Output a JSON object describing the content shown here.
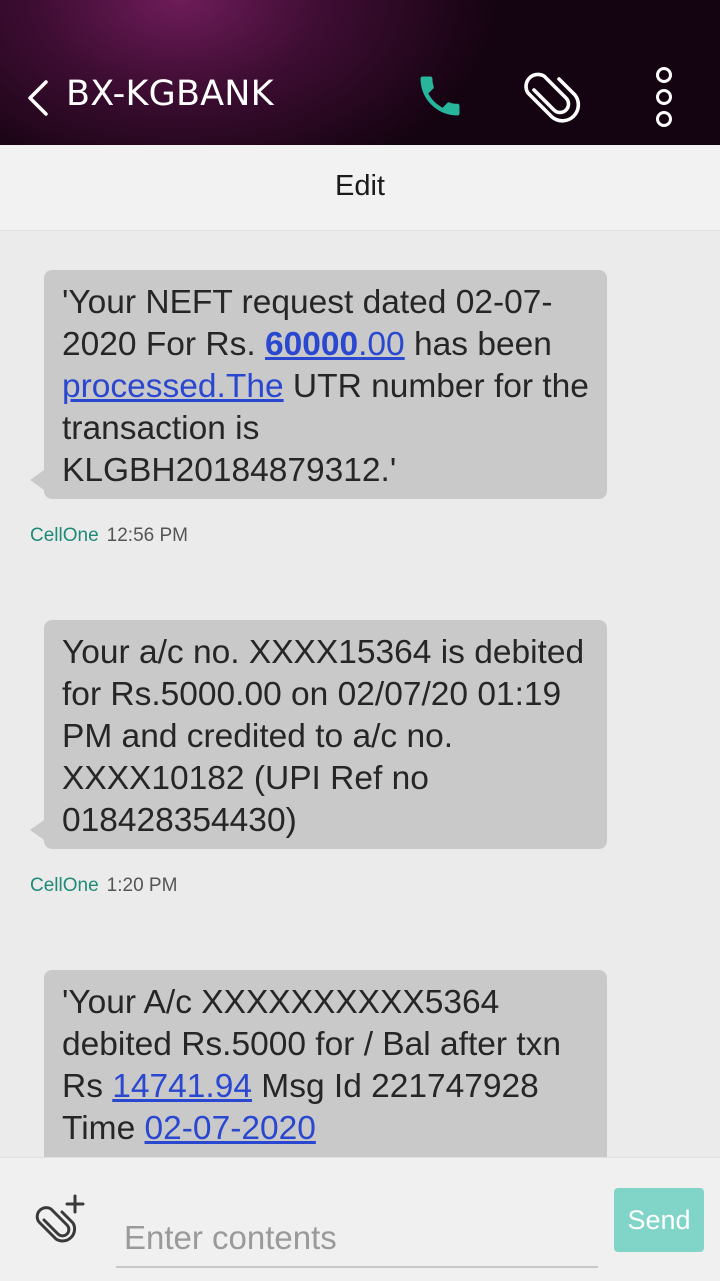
{
  "header": {
    "title": "BX-KGBANK",
    "icons": [
      "back-arrow-icon",
      "phone-icon",
      "paperclip-icon",
      "more-vertical-icon"
    ]
  },
  "edit_bar": {
    "label": "Edit"
  },
  "messages": [
    {
      "text_parts": [
        "'Your NEFT request dated 02-07-2020 For Rs. ",
        "60000",
        ".00",
        " has been ",
        "processed.The",
        " UTR number for the transaction is KLGBH20184879312.'"
      ],
      "sim": "CellOne",
      "time": "12:56 PM"
    },
    {
      "text": "Your a/c no. XXXX15364 is debited for Rs.5000.00 on 02/07/20 01:19 PM and credited to a/c no. XXXX10182 (UPI Ref no 018428354430)",
      "sim": "CellOne",
      "time": "1:20 PM"
    },
    {
      "text_parts": [
        "'Your A/c XXXXXXXXXX5364 debited Rs.5000 for / Bal after txn Rs ",
        "14741.94",
        " Msg Id 221747928 Time ",
        "02-07-2020"
      ]
    }
  ],
  "composer": {
    "placeholder": "Enter contents",
    "send_label": "Send",
    "icons": [
      "attach-add-icon"
    ]
  },
  "colors": {
    "header_bg": "#140310",
    "bubble_bg": "#c9c9c9",
    "link": "#2a47d0",
    "phone_icon": "#27b59b",
    "send_button": "#80d5c8",
    "sim_label": "#1f8a78"
  }
}
